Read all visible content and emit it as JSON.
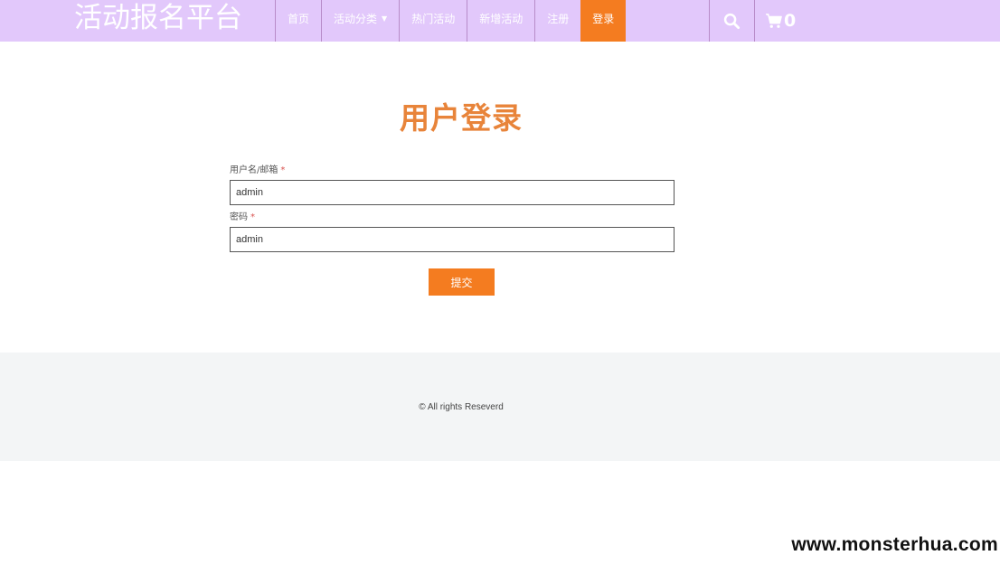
{
  "header": {
    "brand": "活动报名平台",
    "nav": [
      {
        "label": "首页"
      },
      {
        "label": "活动分类",
        "has_dropdown": true
      },
      {
        "label": "热门活动"
      },
      {
        "label": "新增活动"
      },
      {
        "label": "注册"
      },
      {
        "label": "登录",
        "active": true
      }
    ],
    "cart_count": "0",
    "search_icon": "search-icon",
    "cart_icon": "cart-icon"
  },
  "login": {
    "title": "用户登录",
    "username_label": "用户名/邮箱",
    "username_value": "admin",
    "password_label": "密码",
    "password_value": "admin",
    "required_mark": "*",
    "submit_label": "提交"
  },
  "footer": {
    "copyright": "© All rights Reseverd"
  },
  "watermark": "www.monsterhua.com",
  "colors": {
    "navbar_bg": "#e2c8fb",
    "accent": "#f47c20",
    "title": "#e8843a",
    "footer_bg": "#f3f5f6"
  }
}
